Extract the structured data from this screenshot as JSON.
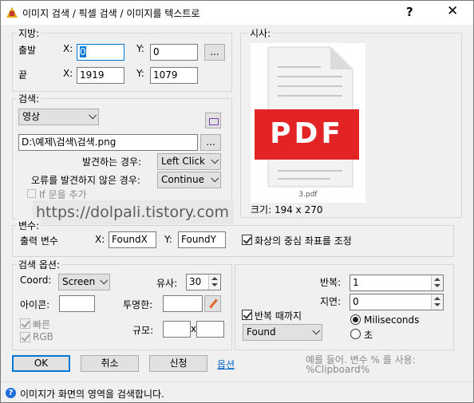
{
  "window": {
    "title": "이미지 검색 / 픽셀 검색 / 이미지를 텍스트로",
    "help_label": "?",
    "close_label": "✕"
  },
  "position": {
    "group_label": "지방:",
    "start_label": "출발",
    "end_label": "끝",
    "x_label": "X:",
    "y_label": "Y:",
    "start_x": "0",
    "start_y": "0",
    "end_x": "1919",
    "end_y": "1079",
    "browse_label": "..."
  },
  "preview": {
    "group_label": "시사:",
    "file_name": "3.pdf",
    "pdf_text": "PDF",
    "size_text": "크기: 194 x 270"
  },
  "search": {
    "group_label": "검색:",
    "mode_value": "영상",
    "path_value": "D:\\예제\\검색\\검색.png",
    "browse_label": "...",
    "if_found_label": "발견하는 경우:",
    "if_found_value": "Left Click",
    "if_not_found_label": "오류를 발견하지 않은 경우:",
    "if_not_found_value": "Continue",
    "add_if_label": "If 문을 추가"
  },
  "variables": {
    "group_label": "변수:",
    "output_label": "출력 변수",
    "x_label": "X:",
    "y_label": "Y:",
    "x_value": "FoundX",
    "y_value": "FoundY",
    "center_label": "화상의 중심 좌표를 조정"
  },
  "options": {
    "group_label": "검색 옵션:",
    "coord_label": "Coord:",
    "coord_value": "Screen",
    "similarity_label": "유사:",
    "similarity_value": "30",
    "icon_label": "아이콘:",
    "transparent_label": "투명한:",
    "fast_label": "빠른",
    "rgb_label": "RGB",
    "scale_label": "규모:",
    "scale_x_sep": "x"
  },
  "repeat": {
    "repeat_label": "반복:",
    "repeat_value": "1",
    "delay_label": "지연:",
    "delay_value": "0",
    "until_label": "반복 때까지",
    "until_value": "Found",
    "ms_label": "Miliseconds",
    "sec_label": "초",
    "hint": "예를 들어. 변수 % 를 사용: %Clipboard%"
  },
  "buttons": {
    "ok": "OK",
    "cancel": "취소",
    "apply": "신청",
    "options_link": "옵션"
  },
  "watermark": "https://dolpali.tistory.com",
  "status": "이미지가 화면의 영역을 검색합니다."
}
